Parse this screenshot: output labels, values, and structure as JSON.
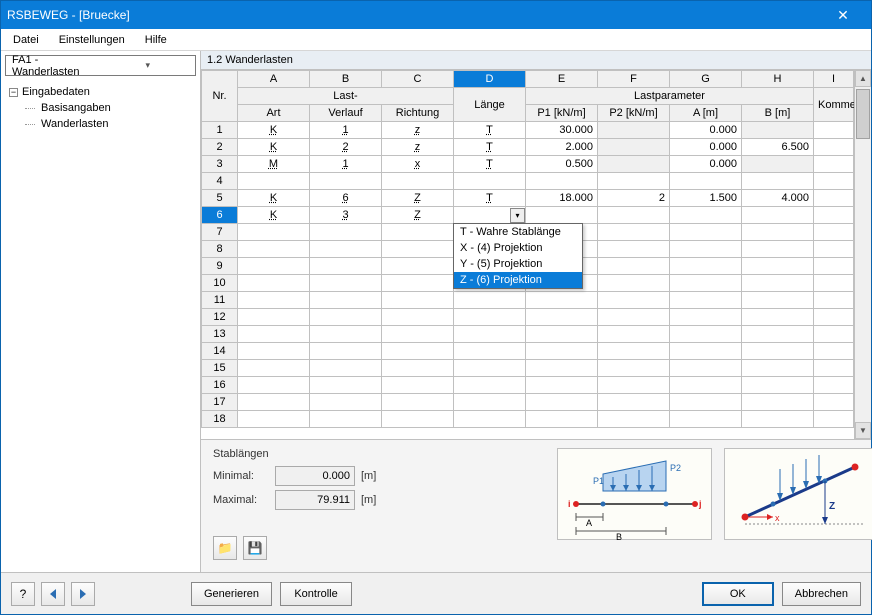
{
  "window": {
    "title": "RSBEWEG - [Bruecke]"
  },
  "menubar": {
    "items": [
      "Datei",
      "Einstellungen",
      "Hilfe"
    ]
  },
  "left": {
    "combo": "FA1 - Wanderlasten",
    "tree_root": "Eingabedaten",
    "tree_children": [
      "Basisangaben",
      "Wanderlasten"
    ]
  },
  "panel_title": "1.2 Wanderlasten",
  "columns": {
    "letters": [
      "A",
      "B",
      "C",
      "D",
      "E",
      "F",
      "G",
      "H",
      "I"
    ],
    "group1": "Last-",
    "group2": "Lastparameter",
    "labels": {
      "nr": "Nr.",
      "a": "Art",
      "b": "Verlauf",
      "c": "Richtung",
      "d": "Länge",
      "e": "P1 [kN/m]",
      "f": "P2 [kN/m]",
      "g": "A [m]",
      "h": "B [m]",
      "i": "Kommentar"
    }
  },
  "rows_count": 18,
  "rows": [
    {
      "nr": "1",
      "a": "K",
      "b": "1",
      "c": "z",
      "d": "T",
      "e": "30.000",
      "f": "",
      "g": "0.000",
      "h": "",
      "i": "",
      "f_grey": true,
      "h_grey": true
    },
    {
      "nr": "2",
      "a": "K",
      "b": "2",
      "c": "z",
      "d": "T",
      "e": "2.000",
      "f": "",
      "g": "0.000",
      "h": "6.500",
      "i": "",
      "f_grey": true
    },
    {
      "nr": "3",
      "a": "M",
      "b": "1",
      "c": "x",
      "d": "T",
      "e": "0.500",
      "f": "",
      "g": "0.000",
      "h": "",
      "i": "",
      "f_grey": true,
      "h_grey": true
    },
    {
      "nr": "4",
      "a": "",
      "b": "",
      "c": "",
      "d": "",
      "e": "",
      "f": "",
      "g": "",
      "h": "",
      "i": ""
    },
    {
      "nr": "5",
      "a": "K",
      "b": "6",
      "c": "Z",
      "d": "T",
      "e": "18.000",
      "f": "2",
      "g": "1.500",
      "h": "4.000",
      "i": ""
    },
    {
      "nr": "6",
      "a": "K",
      "b": "3",
      "c": "Z",
      "d": "",
      "e": "",
      "f": "",
      "g": "",
      "h": "",
      "i": "",
      "dropdown": true,
      "selected_row": true
    }
  ],
  "dropdown": {
    "options": [
      "T - Wahre Stablänge",
      "X - (4) Projektion",
      "Y - (5) Projektion",
      "Z - (6) Projektion"
    ],
    "selected_index": 3
  },
  "stab": {
    "title": "Stablängen",
    "min_label": "Minimal:",
    "min_value": "0.000",
    "max_label": "Maximal:",
    "max_value": "79.911",
    "unit": "[m]"
  },
  "diagram_labels": {
    "p1": "P1",
    "p2": "P2",
    "i": "i",
    "j": "j",
    "A": "A",
    "B": "B",
    "x": "x",
    "z": "Z"
  },
  "footer": {
    "generate": "Generieren",
    "check": "Kontrolle",
    "ok": "OK",
    "cancel": "Abbrechen"
  }
}
